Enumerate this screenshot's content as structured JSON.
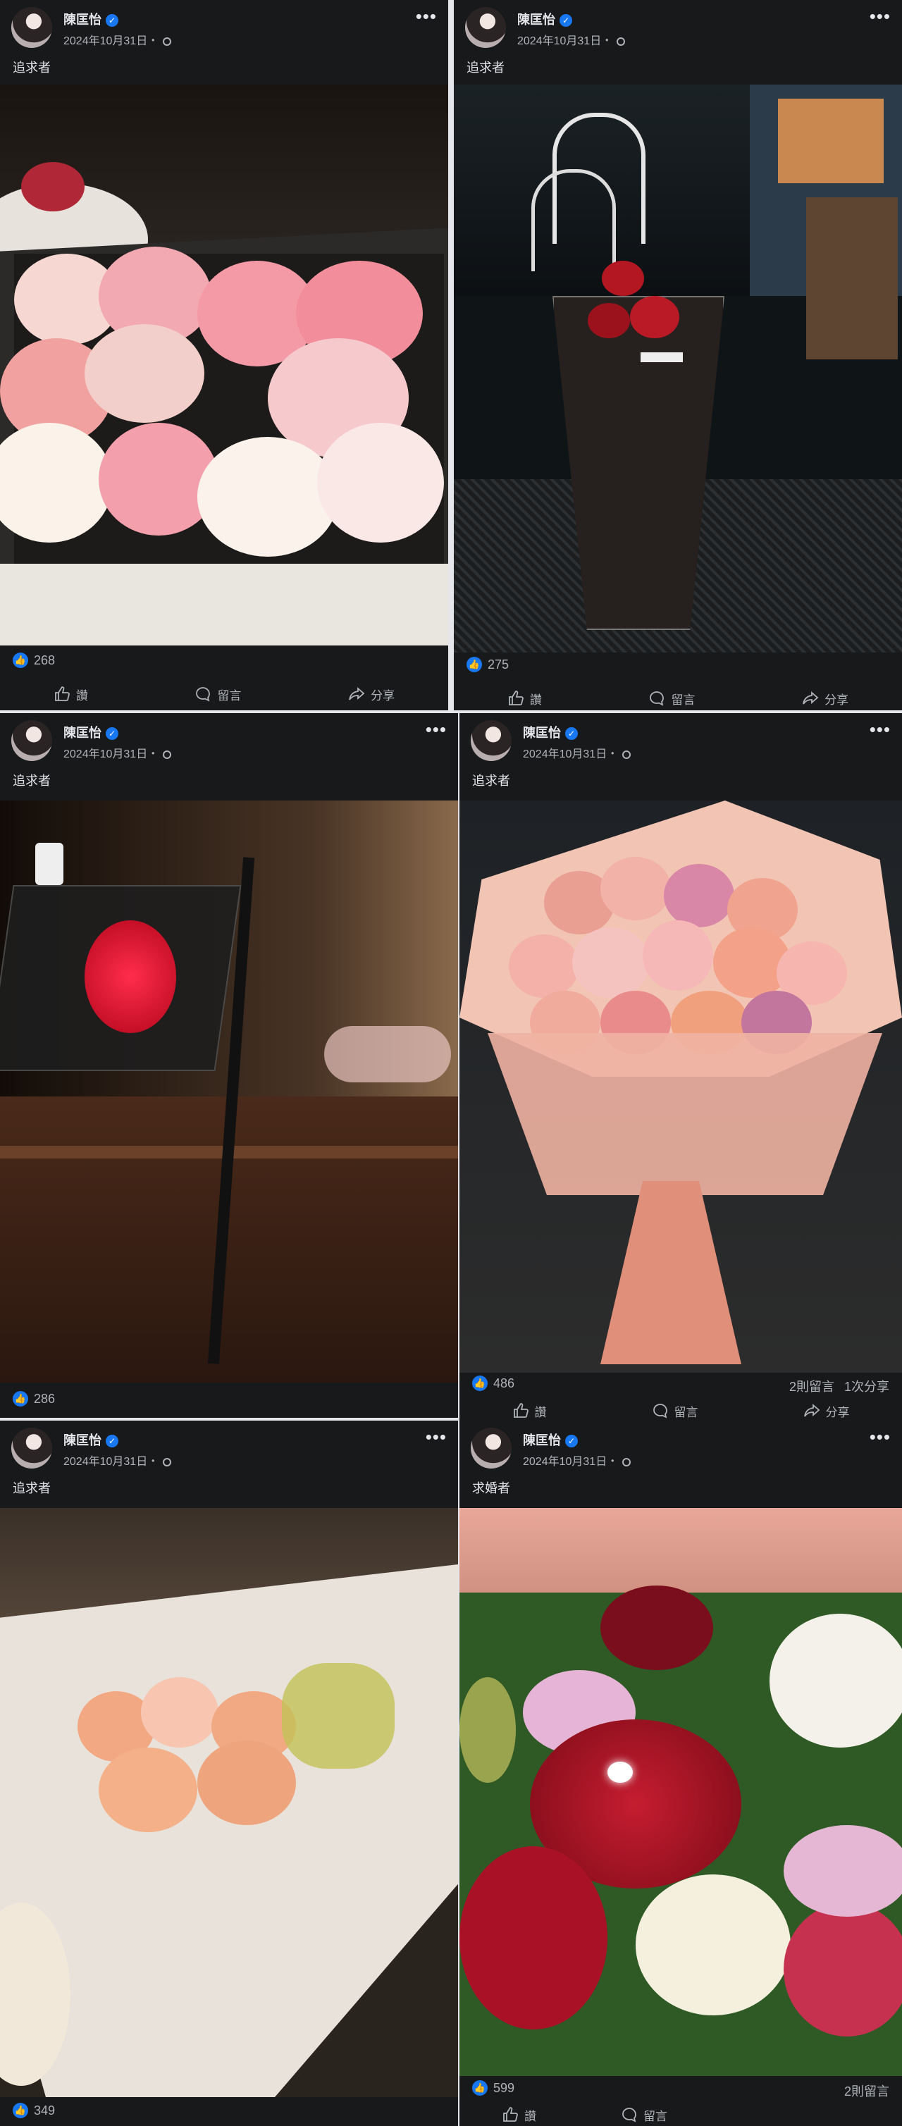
{
  "posts": [
    {
      "author": "陳匡怡",
      "date": "2024年10月31日・",
      "caption": "追求者",
      "likes": "268",
      "like_action": "讚",
      "comment_action": "留言",
      "share_action": "分享"
    },
    {
      "author": "陳匡怡",
      "date": "2024年10月31日・",
      "caption": "追求者",
      "likes": "275",
      "like_action": "讚",
      "comment_action": "留言",
      "share_action": "分享"
    },
    {
      "author": "陳匡怡",
      "date": "2024年10月31日・",
      "caption": "追求者",
      "likes": "286"
    },
    {
      "author": "陳匡怡",
      "date": "2024年10月31日・",
      "caption": "追求者",
      "likes": "486",
      "comments": "2則留言",
      "shares": "1次分享",
      "like_action": "讚",
      "comment_action": "留言",
      "share_action": "分享"
    },
    {
      "author": "陳匡怡",
      "date": "2024年10月31日・",
      "caption": "追求者",
      "likes": "349"
    },
    {
      "author": "陳匡怡",
      "date": "2024年10月31日・",
      "caption": "求婚者",
      "likes": "599",
      "comments": "2則留言",
      "like_action": "讚",
      "comment_action": "留言"
    }
  ],
  "icons": {
    "verified": "verified-badge-icon",
    "more": "more-options-icon",
    "globe": "public-globe-icon",
    "like": "thumbs-up-icon",
    "comment": "comment-bubble-icon",
    "share": "share-arrow-icon"
  },
  "colors": {
    "background": "#18191a",
    "text": "#e4e6eb",
    "muted": "#b0b3b8",
    "brand": "#1877f2"
  }
}
